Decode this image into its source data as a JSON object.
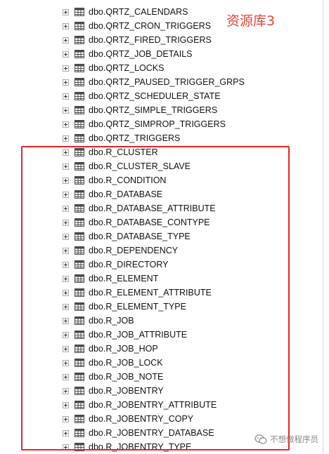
{
  "annotation": {
    "label": "资源库3",
    "color": "#e8423b",
    "highlight_color": "#e8262a"
  },
  "tree": {
    "expander_icon": "plus-square-icon",
    "node_icon": "table-grid-icon",
    "items": [
      "dbo.QRTZ_CALENDARS",
      "dbo.QRTZ_CRON_TRIGGERS",
      "dbo.QRTZ_FIRED_TRIGGERS",
      "dbo.QRTZ_JOB_DETAILS",
      "dbo.QRTZ_LOCKS",
      "dbo.QRTZ_PAUSED_TRIGGER_GRPS",
      "dbo.QRTZ_SCHEDULER_STATE",
      "dbo.QRTZ_SIMPLE_TRIGGERS",
      "dbo.QRTZ_SIMPROP_TRIGGERS",
      "dbo.QRTZ_TRIGGERS",
      "dbo.R_CLUSTER",
      "dbo.R_CLUSTER_SLAVE",
      "dbo.R_CONDITION",
      "dbo.R_DATABASE",
      "dbo.R_DATABASE_ATTRIBUTE",
      "dbo.R_DATABASE_CONTYPE",
      "dbo.R_DATABASE_TYPE",
      "dbo.R_DEPENDENCY",
      "dbo.R_DIRECTORY",
      "dbo.R_ELEMENT",
      "dbo.R_ELEMENT_ATTRIBUTE",
      "dbo.R_ELEMENT_TYPE",
      "dbo.R_JOB",
      "dbo.R_JOB_ATTRIBUTE",
      "dbo.R_JOB_HOP",
      "dbo.R_JOB_LOCK",
      "dbo.R_JOB_NOTE",
      "dbo.R_JOBENTRY",
      "dbo.R_JOBENTRY_ATTRIBUTE",
      "dbo.R_JOBENTRY_COPY",
      "dbo.R_JOBENTRY_DATABASE",
      "dbo.R_JOBENTRY_TYPE"
    ]
  },
  "watermark": {
    "text": "不想做程序员",
    "icon": "wechat-logo-icon"
  }
}
